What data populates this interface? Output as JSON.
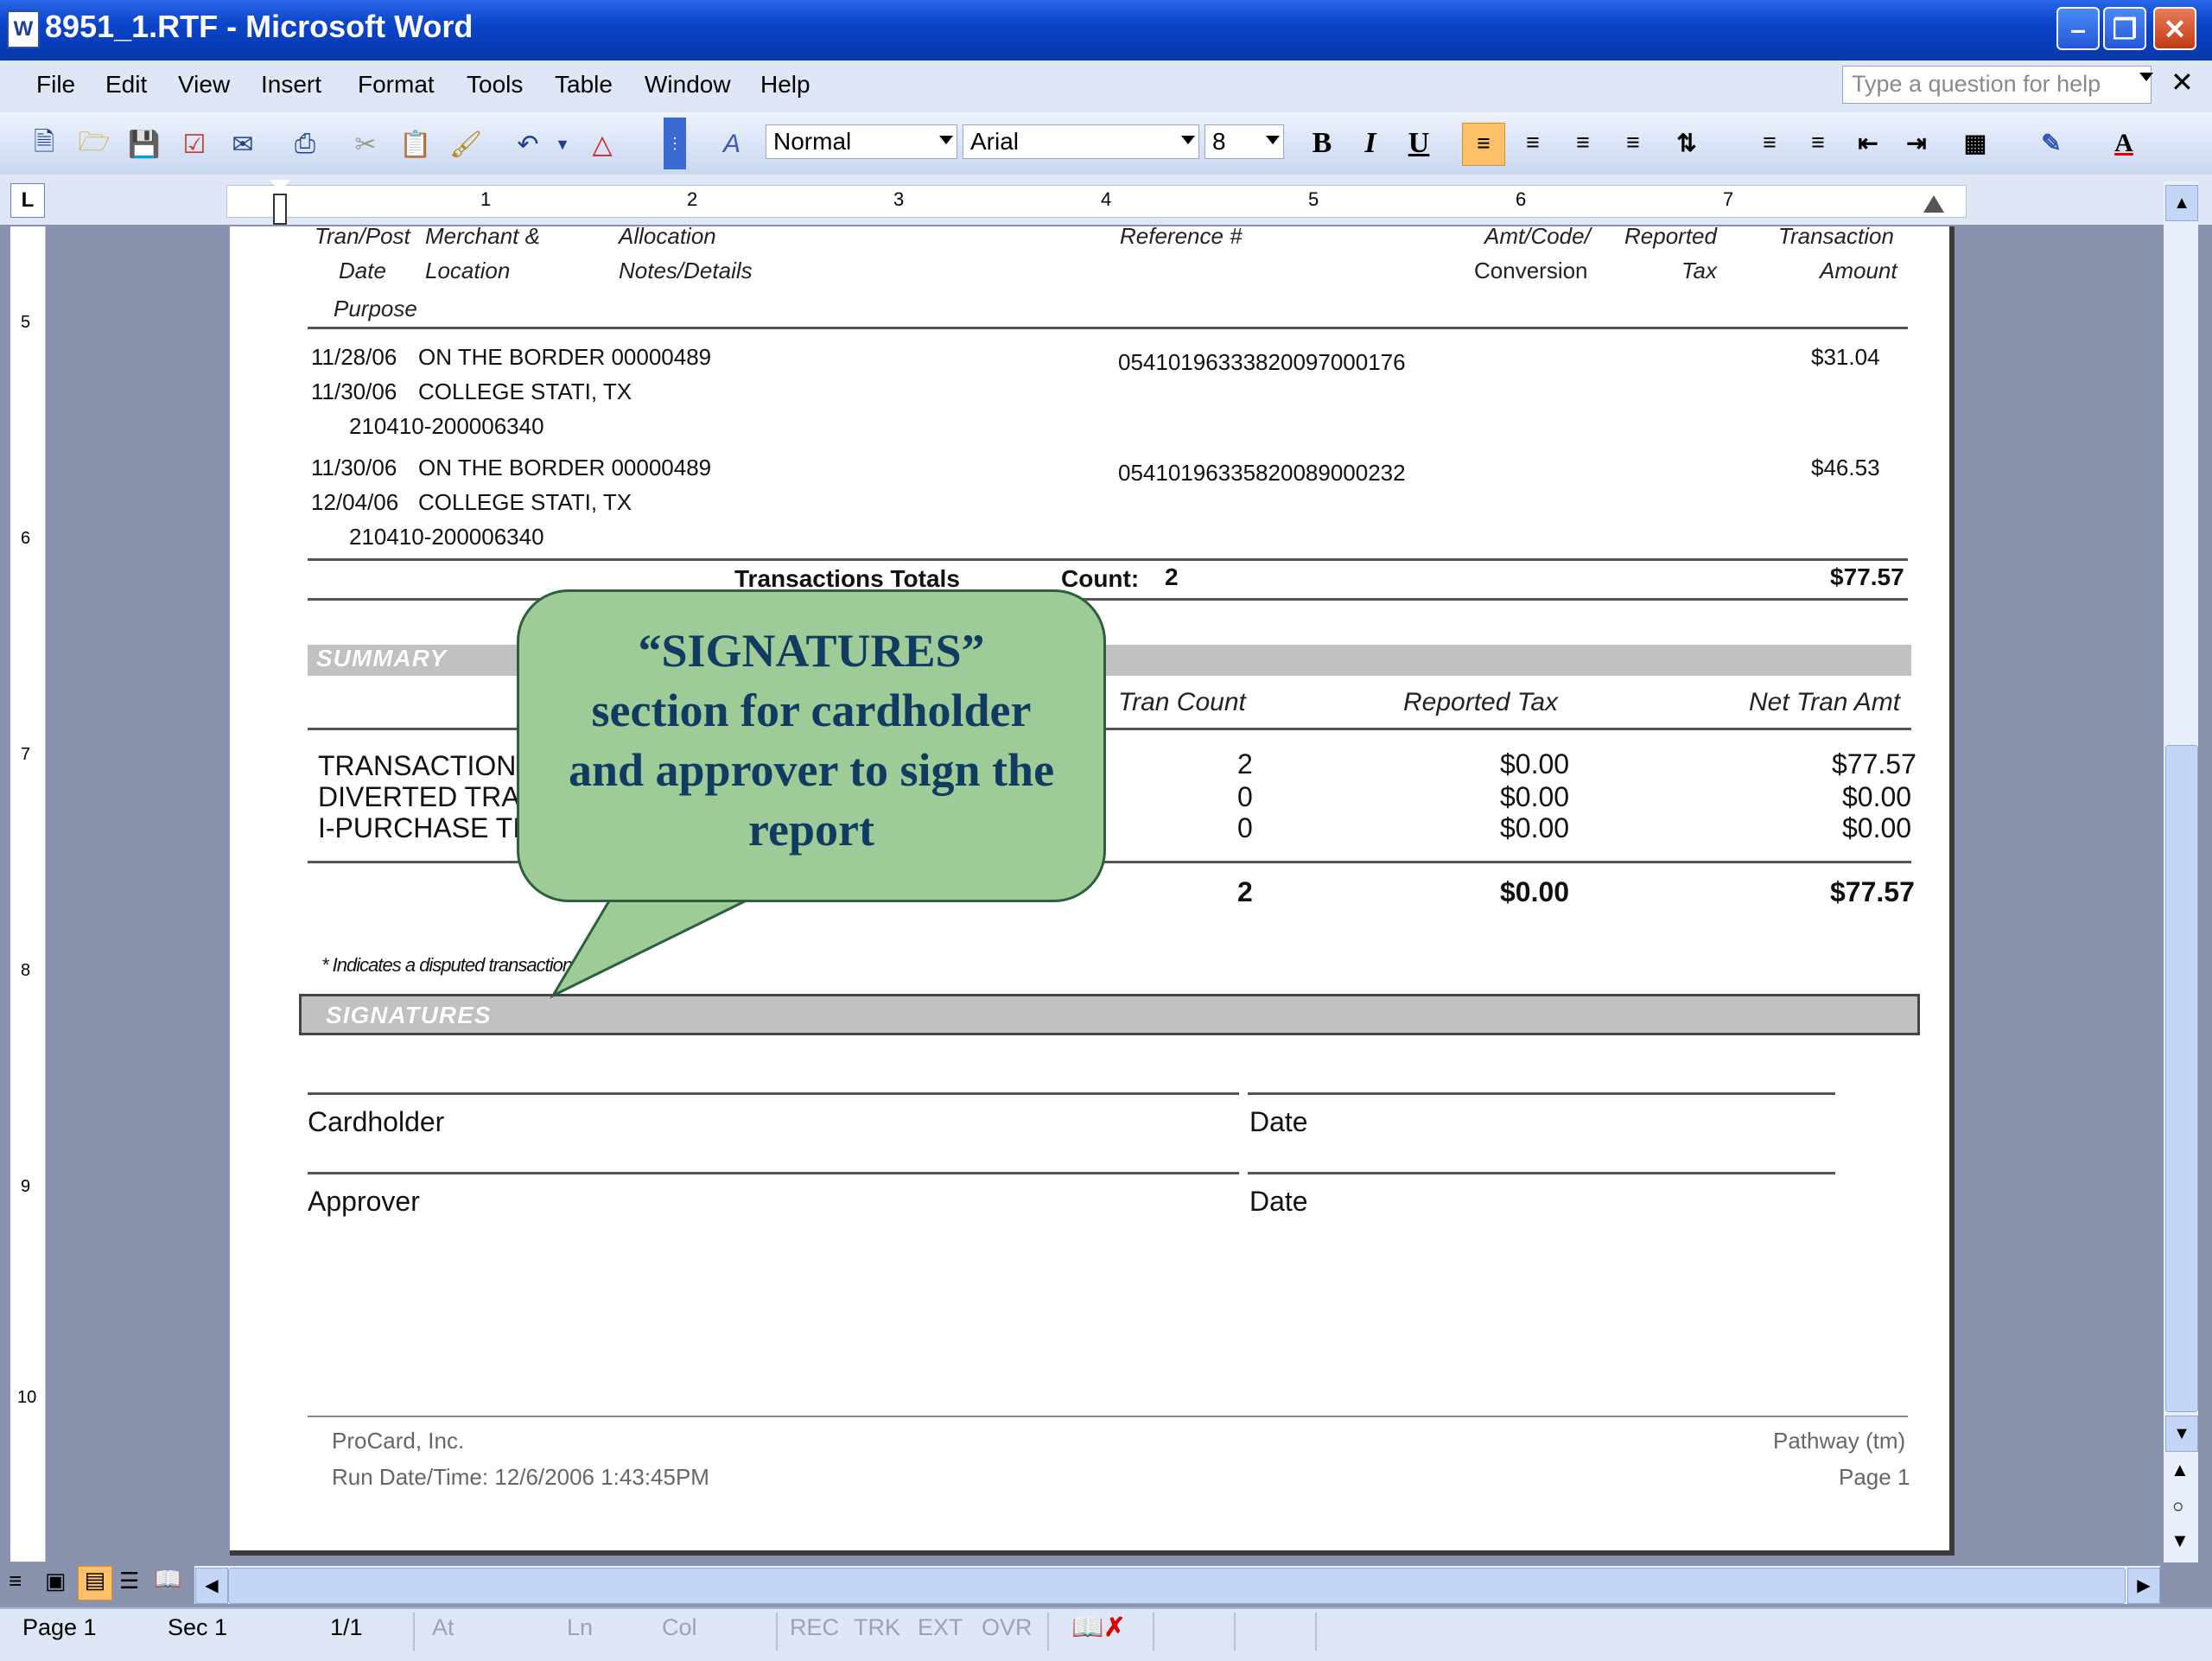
{
  "window": {
    "title": "8951_1.RTF - Microsoft Word",
    "icon_letter": "W"
  },
  "menu": [
    "File",
    "Edit",
    "View",
    "Insert",
    "Format",
    "Tools",
    "Table",
    "Window",
    "Help"
  ],
  "help_placeholder": "Type a question for help",
  "toolbar": {
    "style": "Normal",
    "font": "Arial",
    "size": "8",
    "bold": "B",
    "italic": "I",
    "underline": "U"
  },
  "ruler_numbers": [
    "1",
    "2",
    "3",
    "4",
    "5",
    "6",
    "7"
  ],
  "vruler_numbers": [
    "5",
    "6",
    "7",
    "8",
    "9",
    "10"
  ],
  "transactions": {
    "headers": {
      "tran_post": [
        "Tran/Post",
        "Date",
        "Purpose"
      ],
      "merchant": [
        "Merchant &",
        "Location"
      ],
      "allocation": [
        "Allocation",
        "Notes/Details"
      ],
      "reference": "Reference #",
      "amt_code": [
        "Amt/Code/",
        "Conversion"
      ],
      "reported": [
        "Reported",
        "Tax"
      ],
      "amount": [
        "Transaction",
        "Amount"
      ]
    },
    "rows": [
      {
        "date1": "11/28/06",
        "merchant": "ON THE BORDER 00000489",
        "date2": "11/30/06",
        "location": "COLLEGE STATI, TX",
        "purpose": "210410-200006340",
        "reference": "05410196333820097000176",
        "amount": "$31.04"
      },
      {
        "date1": "11/30/06",
        "merchant": "ON THE BORDER 00000489",
        "date2": "12/04/06",
        "location": "COLLEGE STATI, TX",
        "purpose": "210410-200006340",
        "reference": "05410196335820089000232",
        "amount": "$46.53"
      }
    ],
    "totals_label": "Transactions Totals",
    "count_label": "Count:",
    "count": "2",
    "total": "$77.57"
  },
  "summary": {
    "title": "SUMMARY",
    "headers": {
      "count": "Tran Count",
      "tax": "Reported Tax",
      "net": "Net Tran Amt"
    },
    "rows": [
      {
        "label": "TRANSACTIONS",
        "count": "2",
        "tax": "$0.00",
        "net": "$77.57"
      },
      {
        "label": "DIVERTED TRA",
        "count": "0",
        "tax": "$0.00",
        "net": "$0.00"
      },
      {
        "label": "I-PURCHASE TI",
        "count": "0",
        "tax": "$0.00",
        "net": "$0.00"
      }
    ],
    "total_count": "2",
    "total_tax": "$0.00",
    "total_net": "$77.57",
    "note": "* Indicates a disputed transaction"
  },
  "signatures": {
    "title": "SIGNATURES",
    "cardholder": "Cardholder",
    "approver": "Approver",
    "date": "Date"
  },
  "callout": {
    "line1": "“SIGNATURES”",
    "line2": "section for cardholder",
    "line3": "and approver to sign the",
    "line4": "report"
  },
  "footer": {
    "company": "ProCard, Inc.",
    "run_date": "Run Date/Time:  12/6/2006   1:43:45PM",
    "product": "Pathway (tm)",
    "page": "Page 1"
  },
  "status": {
    "page": "Page  1",
    "sec": "Sec  1",
    "pages": "1/1",
    "at": "At",
    "ln": "Ln",
    "col": "Col",
    "rec": "REC",
    "trk": "TRK",
    "ext": "EXT",
    "ovr": "OVR"
  },
  "colors": {
    "title_bar": "#0a44c8",
    "callout_fill": "#9ecb98",
    "callout_text": "#103c62",
    "section_bar": "#c1c1c1"
  }
}
